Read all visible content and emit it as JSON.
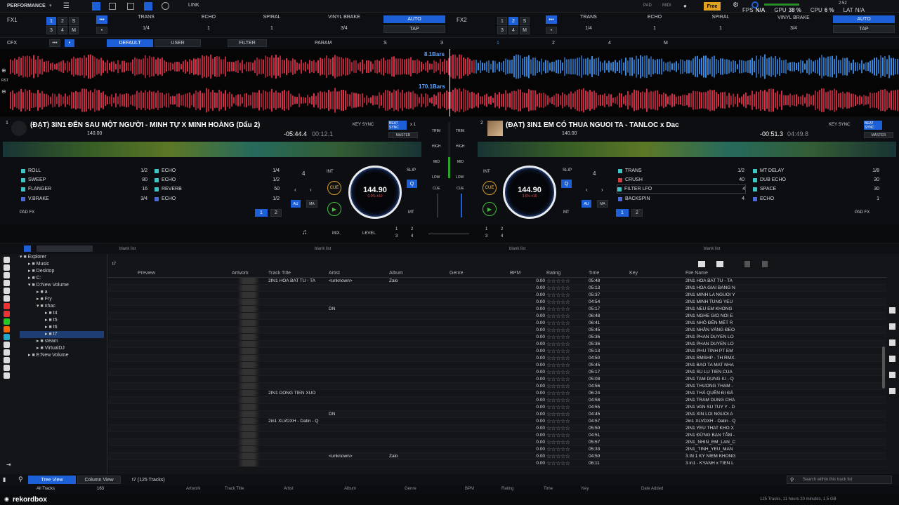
{
  "topbar": {
    "mode": "PERFORMANCE",
    "link": "LINK",
    "pad": "PAD",
    "midi": "MIDI",
    "free": "Free",
    "fps_label": "FPS",
    "fps_value": "N/A",
    "gpu_label": "GPU",
    "gpu_value": "38 %",
    "cpu_label": "CPU",
    "cpu_value": "6 %",
    "lat_label": "LAT",
    "lat_value": "N/A",
    "time": "2:52"
  },
  "fx1": {
    "label": "FX1",
    "nums": [
      "1",
      "2",
      "3",
      "4",
      "M",
      "S"
    ],
    "effects": [
      "TRANS",
      "ECHO",
      "SPIRAL"
    ],
    "beat_values": [
      "1/4",
      "1",
      "1"
    ],
    "brake": "VINYL BRAKE",
    "brake_val": "3/4",
    "auto": "AUTO",
    "tap": "TAP"
  },
  "fx2": {
    "label": "FX2",
    "nums": [
      "1",
      "2",
      "3",
      "4",
      "M",
      "S"
    ],
    "effects": [
      "TRANS",
      "ECHO",
      "SPIRAL"
    ],
    "beat_values": [
      "1/4",
      "1",
      "1"
    ],
    "brake": "VINYL BRAKE",
    "brake_val": "3/4",
    "auto": "AUTO",
    "tap": "TAP"
  },
  "cfx": {
    "label": "CFX",
    "default": "DEFAULT",
    "user": "USER",
    "filter": "FILTER",
    "param": "PARAM",
    "channels": [
      "S",
      "3",
      "1",
      "2",
      "4",
      "M"
    ]
  },
  "waves": {
    "bars1": "8.1Bars",
    "bars2": "170.1Bars",
    "rst": "RST"
  },
  "deck1": {
    "num": "1",
    "title": "(ĐẠT) 3IN1 ĐẾN SAU MỘT NGƯỜI - MINH TỰ X MINH HOÀNG (Dẩu 2)",
    "bpm_small": "140.00",
    "remain": "-05:44.4",
    "elapsed": "00:12.1",
    "key_sync": "KEY SYNC",
    "beat_sync": "BEAT SYNC",
    "x1": "x 1",
    "master": "MASTER",
    "beat_count": "4",
    "bpm": "144.90",
    "bpm_sub": "0.0% ±10",
    "int": "INT",
    "cue": "CUE",
    "slip": "SLIP",
    "q": "Q",
    "au": "AU",
    "ma": "MA",
    "mt": "MT",
    "padfx": "PAD FX",
    "pages": [
      "1",
      "2"
    ],
    "fx_left": [
      {
        "name": "ROLL",
        "val": "1/2"
      },
      {
        "name": "SWEEP",
        "val": "80"
      },
      {
        "name": "FLANGER",
        "val": "16"
      },
      {
        "name": "V.BRAKE",
        "val": "3/4"
      }
    ],
    "fx_right": [
      {
        "name": "ECHO",
        "val": "1/4"
      },
      {
        "name": "ECHO",
        "val": "1/2"
      },
      {
        "name": "REVERB",
        "val": "50"
      },
      {
        "name": "ECHO",
        "val": "1/2"
      }
    ]
  },
  "deck2": {
    "num": "2",
    "title": "(ĐẠT) 3IN1 EM CÓ THUA NGUOI TA - TANLOC x Dac",
    "bpm_small": "140.00",
    "remain": "-00:51.3",
    "elapsed": "04:49.8",
    "key_sync": "KEY SYNC",
    "beat_sync": "BEAT SYNC",
    "x1": "x 1",
    "master": "MASTER",
    "beat_count": "4",
    "bpm": "144.90",
    "bpm_sub": "3.5% ±10",
    "int": "INT",
    "cue": "CUE",
    "slip": "SLIP",
    "q": "Q",
    "au": "AU",
    "ma": "MA",
    "mt": "MT",
    "padfx": "PAD FX",
    "pages": [
      "1",
      "2"
    ],
    "fx_left": [
      {
        "name": "TRANS",
        "val": "1/2"
      },
      {
        "name": "CRUSH",
        "val": "40"
      },
      {
        "name": "FILTER LFO",
        "val": "4"
      },
      {
        "name": "BACKSPIN",
        "val": "4"
      }
    ],
    "fx_right": [
      {
        "name": "MT DELAY",
        "val": "1/8"
      },
      {
        "name": "DUB ECHO",
        "val": "30"
      },
      {
        "name": "SPACE",
        "val": "30"
      },
      {
        "name": "ECHO",
        "val": "1"
      }
    ]
  },
  "mixer": {
    "trim": "TRIM",
    "high": "HIGH",
    "mid": "MID",
    "low": "LOW",
    "cue": "CUE",
    "mix": "MIX",
    "level": "LEVEL",
    "ch_left": [
      "1",
      "2",
      "3",
      "4"
    ],
    "ch_right": [
      "1",
      "2",
      "3",
      "4"
    ]
  },
  "browser": {
    "panes": [
      "blank list",
      "blank list",
      "blank list",
      "blank list"
    ],
    "tree": [
      {
        "label": "Explorer",
        "indent": 0
      },
      {
        "label": "Music",
        "indent": 1
      },
      {
        "label": "Desktop",
        "indent": 1
      },
      {
        "label": "C:",
        "indent": 1
      },
      {
        "label": "D:New Volume",
        "indent": 1
      },
      {
        "label": "a",
        "indent": 2
      },
      {
        "label": "Fry",
        "indent": 2
      },
      {
        "label": "nhac",
        "indent": 2
      },
      {
        "label": "t4",
        "indent": 3
      },
      {
        "label": "t5",
        "indent": 3
      },
      {
        "label": "t6",
        "indent": 3
      },
      {
        "label": "t7",
        "indent": 3
      },
      {
        "label": "steam",
        "indent": 2
      },
      {
        "label": "VirtualDJ",
        "indent": 2
      },
      {
        "label": "E:New Volume",
        "indent": 1
      }
    ],
    "path": "t7",
    "columns": [
      "Preview",
      "Artwork",
      "Track Title",
      "Artist",
      "Album",
      "Genre",
      "BPM",
      "Rating",
      "Time",
      "Key",
      "File Name"
    ],
    "rows": [
      {
        "title": "2IN1 HOA BAT TU - TA",
        "artist": "<unknown>",
        "album": "Zalo",
        "bpm": "0.00",
        "time": "05:48",
        "file": "2IN1 HOA BAT TU - TA"
      },
      {
        "title": "",
        "artist": "",
        "album": "",
        "bpm": "0.00",
        "time": "05:13",
        "file": "2IN1 HOA GIAI BANG N"
      },
      {
        "title": "",
        "artist": "",
        "album": "",
        "bpm": "0.00",
        "time": "05:37",
        "file": "2IN1 MINH LA NGUOI Y"
      },
      {
        "title": "",
        "artist": "",
        "album": "",
        "bpm": "0.00",
        "time": "04:54",
        "file": "2IN1 MINH TUNG YEU"
      },
      {
        "title": "",
        "artist": "DN",
        "album": "",
        "bpm": "0.00",
        "time": "05:17",
        "file": "2IN1 NEU EM KHONG"
      },
      {
        "title": "",
        "artist": "",
        "album": "",
        "bpm": "0.00",
        "time": "06:48",
        "file": "2IN1 NGHE GIO NOI E"
      },
      {
        "title": "",
        "artist": "",
        "album": "",
        "bpm": "0.00",
        "time": "06:41",
        "file": "2IN1 NHỎ ĐẾN MÉT R"
      },
      {
        "title": "",
        "artist": "",
        "album": "",
        "bpm": "0.00",
        "time": "05:45",
        "file": "2IN1 NHÂN VÀNG ĐEO"
      },
      {
        "title": "",
        "artist": "",
        "album": "",
        "bpm": "0.00",
        "time": "05:36",
        "file": "2IN1 PHAN DUYEN LO"
      },
      {
        "title": "",
        "artist": "",
        "album": "",
        "bpm": "0.00",
        "time": "05:36",
        "file": "2IN1 PHAN DUYEN LO"
      },
      {
        "title": "",
        "artist": "",
        "album": "",
        "bpm": "0.00",
        "time": "05:13",
        "file": "2IN1 PHU TINH PT EM"
      },
      {
        "title": "",
        "artist": "",
        "album": "",
        "bpm": "0.00",
        "time": "04:50",
        "file": "2IN1 RMSHP - TH RMX."
      },
      {
        "title": "",
        "artist": "",
        "album": "",
        "bpm": "0.00",
        "time": "05:45",
        "file": "2IN1 BAO TA MAT NHA"
      },
      {
        "title": "",
        "artist": "",
        "album": "",
        "bpm": "0.00",
        "time": "05:17",
        "file": "2IN1 SU LU TIEN CUA"
      },
      {
        "title": "",
        "artist": "",
        "album": "",
        "bpm": "0.00",
        "time": "05:08",
        "file": "2IN1 TAM DUNG IU - Q"
      },
      {
        "title": "",
        "artist": "",
        "album": "",
        "bpm": "0.00",
        "time": "04:56",
        "file": "2IN1 THUONG THAM -"
      },
      {
        "title": "2IN1 DONG TIEN XUO",
        "artist": "",
        "album": "",
        "bpm": "0.00",
        "time": "06:24",
        "file": "2IN1 THÁ QUÊN ĐI ĐÀ"
      },
      {
        "title": "",
        "artist": "",
        "album": "",
        "bpm": "0.00",
        "time": "04:58",
        "file": "2IN1 TRAM DUNG CHA"
      },
      {
        "title": "",
        "artist": "",
        "album": "",
        "bpm": "0.00",
        "time": "04:55",
        "file": "2IN1 VAN SU TUY Y - D"
      },
      {
        "title": "",
        "artist": "DN",
        "album": "",
        "bpm": "0.00",
        "time": "04:45",
        "file": "2IN1 XIN LOI NGUOI A"
      },
      {
        "title": "2in1 XLVDXH - Datin - Q",
        "artist": "",
        "album": "",
        "bpm": "0.00",
        "time": "04:57",
        "file": "2in1 XLVDXH - Datin - Q"
      },
      {
        "title": "",
        "artist": "",
        "album": "",
        "bpm": "0.00",
        "time": "05:50",
        "file": "2IN1 YEU THAT KHO X"
      },
      {
        "title": "",
        "artist": "",
        "album": "",
        "bpm": "0.00",
        "time": "04:51",
        "file": "2IN1 ĐỪNG BẠN TÂM -"
      },
      {
        "title": "",
        "artist": "",
        "album": "",
        "bpm": "0.00",
        "time": "05:57",
        "file": "2IN1_NHIN_EM_LAN_C"
      },
      {
        "title": "",
        "artist": "",
        "album": "",
        "bpm": "0.00",
        "time": "05:33",
        "file": "2IN1_TINH_YEU_MAN"
      },
      {
        "title": "",
        "artist": "<unknown>",
        "album": "Zalo",
        "bpm": "0.00",
        "time": "04:50",
        "file": "3 IN 1 KY NIEM KHONG"
      },
      {
        "title": "",
        "artist": "",
        "album": "",
        "bpm": "0.00",
        "time": "06:11",
        "file": "3 in1 - KYANH x TIEN L"
      }
    ],
    "tree_view": "Tree View",
    "column_view": "Column View",
    "track_count": "t7 (125 Tracks)",
    "all_tracks": "All Tracks",
    "all_tracks_count": "163",
    "search_placeholder": "Search within this track list",
    "bottom_columns": [
      "Artwork",
      "Track Title",
      "Artist",
      "Album",
      "Genre",
      "BPM",
      "Rating",
      "Time",
      "Key",
      "Date Added"
    ],
    "status": "125 Tracks, 11 hours 20 minutes, 1.5 GB",
    "brand": "rekordbox"
  },
  "colors": {
    "accent": "#1d5fd6",
    "wave_red": "#e0304a",
    "wave_blue": "#3a8ee8",
    "fx_teal": "#3ec6c6",
    "free_badge": "#e0a020"
  }
}
